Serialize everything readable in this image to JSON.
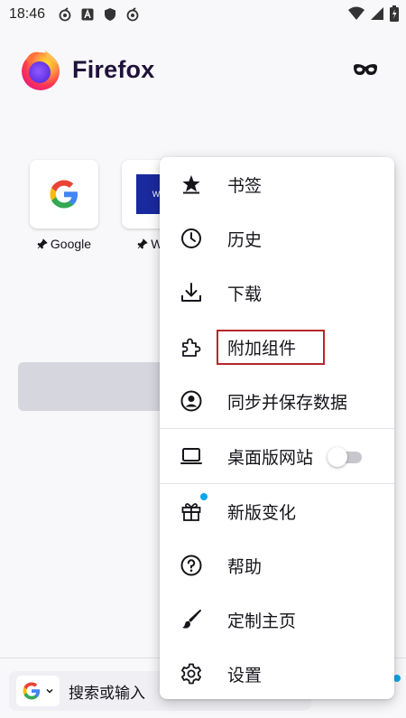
{
  "status_bar": {
    "time": "18:46",
    "left_icons": [
      "cast-icon",
      "a-badge-icon",
      "shield-icon",
      "cast-icon"
    ],
    "right_icons": [
      "wifi-icon",
      "signal-icon",
      "battery-icon"
    ]
  },
  "header": {
    "brand_name": "Firefox",
    "logo": "firefox-logo-icon",
    "private_mode_icon": "private-mask-icon"
  },
  "shortcuts": [
    {
      "label": "Google",
      "icon": "google-logo-icon",
      "pinned": true
    },
    {
      "label": "Wiki",
      "icon": "wikipedia-icon",
      "tile_text": "W",
      "pinned": true
    }
  ],
  "search_bar": {
    "placeholder": "搜索或输入",
    "engine_icon": "google-logo-icon"
  },
  "menu": {
    "items": [
      {
        "label": "书签",
        "icon": "bookmark-star-icon"
      },
      {
        "label": "历史",
        "icon": "history-clock-icon"
      },
      {
        "label": "下载",
        "icon": "download-icon"
      },
      {
        "label": "附加组件",
        "icon": "addons-puzzle-icon",
        "highlighted": true
      },
      {
        "label": "同步并保存数据",
        "icon": "account-icon"
      },
      {
        "label": "桌面版网站",
        "icon": "desktop-icon",
        "toggle": false
      },
      {
        "label": "新版变化",
        "icon": "gift-icon",
        "badge": true
      },
      {
        "label": "帮助",
        "icon": "help-icon"
      },
      {
        "label": "定制主页",
        "icon": "brush-icon"
      },
      {
        "label": "设置",
        "icon": "settings-gear-icon"
      }
    ]
  },
  "colors": {
    "accent_dot": "#0ea5e9",
    "highlight_border": "#b5272d",
    "text": "#15141a"
  }
}
